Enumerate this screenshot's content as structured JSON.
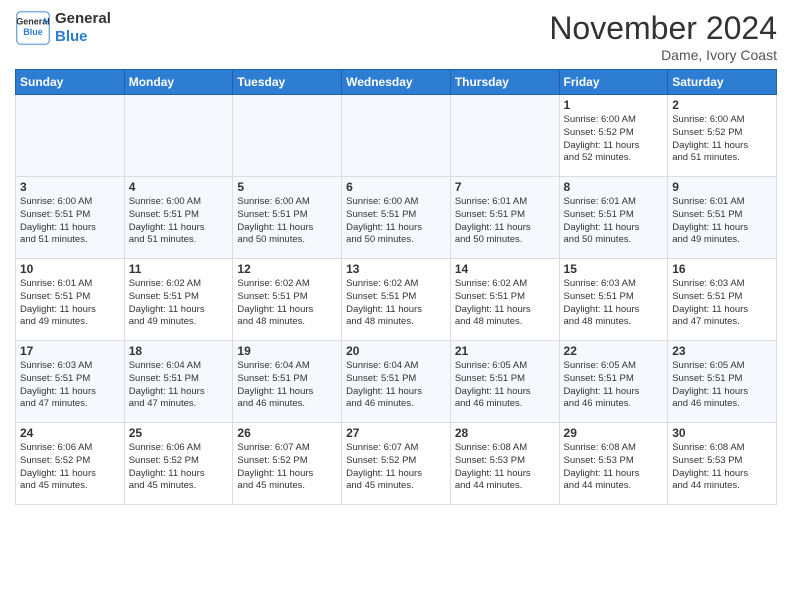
{
  "header": {
    "logo_line1": "General",
    "logo_line2": "Blue",
    "month": "November 2024",
    "location": "Dame, Ivory Coast"
  },
  "weekdays": [
    "Sunday",
    "Monday",
    "Tuesday",
    "Wednesday",
    "Thursday",
    "Friday",
    "Saturday"
  ],
  "weeks": [
    [
      {
        "day": "",
        "info": ""
      },
      {
        "day": "",
        "info": ""
      },
      {
        "day": "",
        "info": ""
      },
      {
        "day": "",
        "info": ""
      },
      {
        "day": "",
        "info": ""
      },
      {
        "day": "1",
        "info": "Sunrise: 6:00 AM\nSunset: 5:52 PM\nDaylight: 11 hours\nand 52 minutes."
      },
      {
        "day": "2",
        "info": "Sunrise: 6:00 AM\nSunset: 5:52 PM\nDaylight: 11 hours\nand 51 minutes."
      }
    ],
    [
      {
        "day": "3",
        "info": "Sunrise: 6:00 AM\nSunset: 5:51 PM\nDaylight: 11 hours\nand 51 minutes."
      },
      {
        "day": "4",
        "info": "Sunrise: 6:00 AM\nSunset: 5:51 PM\nDaylight: 11 hours\nand 51 minutes."
      },
      {
        "day": "5",
        "info": "Sunrise: 6:00 AM\nSunset: 5:51 PM\nDaylight: 11 hours\nand 50 minutes."
      },
      {
        "day": "6",
        "info": "Sunrise: 6:00 AM\nSunset: 5:51 PM\nDaylight: 11 hours\nand 50 minutes."
      },
      {
        "day": "7",
        "info": "Sunrise: 6:01 AM\nSunset: 5:51 PM\nDaylight: 11 hours\nand 50 minutes."
      },
      {
        "day": "8",
        "info": "Sunrise: 6:01 AM\nSunset: 5:51 PM\nDaylight: 11 hours\nand 50 minutes."
      },
      {
        "day": "9",
        "info": "Sunrise: 6:01 AM\nSunset: 5:51 PM\nDaylight: 11 hours\nand 49 minutes."
      }
    ],
    [
      {
        "day": "10",
        "info": "Sunrise: 6:01 AM\nSunset: 5:51 PM\nDaylight: 11 hours\nand 49 minutes."
      },
      {
        "day": "11",
        "info": "Sunrise: 6:02 AM\nSunset: 5:51 PM\nDaylight: 11 hours\nand 49 minutes."
      },
      {
        "day": "12",
        "info": "Sunrise: 6:02 AM\nSunset: 5:51 PM\nDaylight: 11 hours\nand 48 minutes."
      },
      {
        "day": "13",
        "info": "Sunrise: 6:02 AM\nSunset: 5:51 PM\nDaylight: 11 hours\nand 48 minutes."
      },
      {
        "day": "14",
        "info": "Sunrise: 6:02 AM\nSunset: 5:51 PM\nDaylight: 11 hours\nand 48 minutes."
      },
      {
        "day": "15",
        "info": "Sunrise: 6:03 AM\nSunset: 5:51 PM\nDaylight: 11 hours\nand 48 minutes."
      },
      {
        "day": "16",
        "info": "Sunrise: 6:03 AM\nSunset: 5:51 PM\nDaylight: 11 hours\nand 47 minutes."
      }
    ],
    [
      {
        "day": "17",
        "info": "Sunrise: 6:03 AM\nSunset: 5:51 PM\nDaylight: 11 hours\nand 47 minutes."
      },
      {
        "day": "18",
        "info": "Sunrise: 6:04 AM\nSunset: 5:51 PM\nDaylight: 11 hours\nand 47 minutes."
      },
      {
        "day": "19",
        "info": "Sunrise: 6:04 AM\nSunset: 5:51 PM\nDaylight: 11 hours\nand 46 minutes."
      },
      {
        "day": "20",
        "info": "Sunrise: 6:04 AM\nSunset: 5:51 PM\nDaylight: 11 hours\nand 46 minutes."
      },
      {
        "day": "21",
        "info": "Sunrise: 6:05 AM\nSunset: 5:51 PM\nDaylight: 11 hours\nand 46 minutes."
      },
      {
        "day": "22",
        "info": "Sunrise: 6:05 AM\nSunset: 5:51 PM\nDaylight: 11 hours\nand 46 minutes."
      },
      {
        "day": "23",
        "info": "Sunrise: 6:05 AM\nSunset: 5:51 PM\nDaylight: 11 hours\nand 46 minutes."
      }
    ],
    [
      {
        "day": "24",
        "info": "Sunrise: 6:06 AM\nSunset: 5:52 PM\nDaylight: 11 hours\nand 45 minutes."
      },
      {
        "day": "25",
        "info": "Sunrise: 6:06 AM\nSunset: 5:52 PM\nDaylight: 11 hours\nand 45 minutes."
      },
      {
        "day": "26",
        "info": "Sunrise: 6:07 AM\nSunset: 5:52 PM\nDaylight: 11 hours\nand 45 minutes."
      },
      {
        "day": "27",
        "info": "Sunrise: 6:07 AM\nSunset: 5:52 PM\nDaylight: 11 hours\nand 45 minutes."
      },
      {
        "day": "28",
        "info": "Sunrise: 6:08 AM\nSunset: 5:53 PM\nDaylight: 11 hours\nand 44 minutes."
      },
      {
        "day": "29",
        "info": "Sunrise: 6:08 AM\nSunset: 5:53 PM\nDaylight: 11 hours\nand 44 minutes."
      },
      {
        "day": "30",
        "info": "Sunrise: 6:08 AM\nSunset: 5:53 PM\nDaylight: 11 hours\nand 44 minutes."
      }
    ]
  ]
}
